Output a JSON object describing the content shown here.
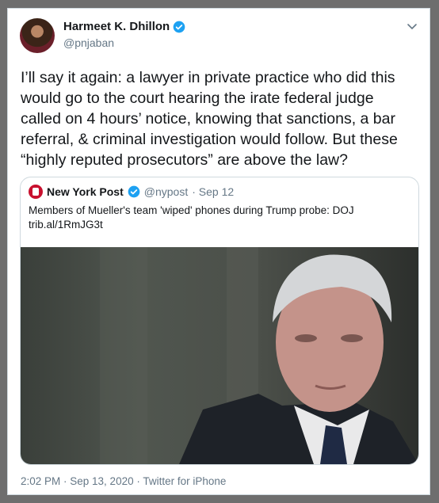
{
  "author": {
    "name": "Harmeet K. Dhillon",
    "handle": "@pnjaban"
  },
  "tweet": {
    "text": "I’ll say it again: a lawyer in private practice who did this\nwould go to the court hearing the irate federal judge\ncalled on 4 hours’ notice, knowing that sanctions, a bar\nreferral, & criminal investigation would follow. But these\n“highly reputed prosecutors” are above the law?"
  },
  "quoted": {
    "name": "New York Post",
    "handle": "@nypost",
    "date": "· Sep 12",
    "text": "Members of Mueller's team 'wiped' phones during Trump probe: DOJ",
    "link": "trib.al/1RmJG3t"
  },
  "footer": "2:02 PM · Sep 13, 2020 · Twitter for iPhone",
  "colors": {
    "verified": "#1da1f2",
    "muted": "#657786",
    "nyp_red": "#c8102e"
  }
}
